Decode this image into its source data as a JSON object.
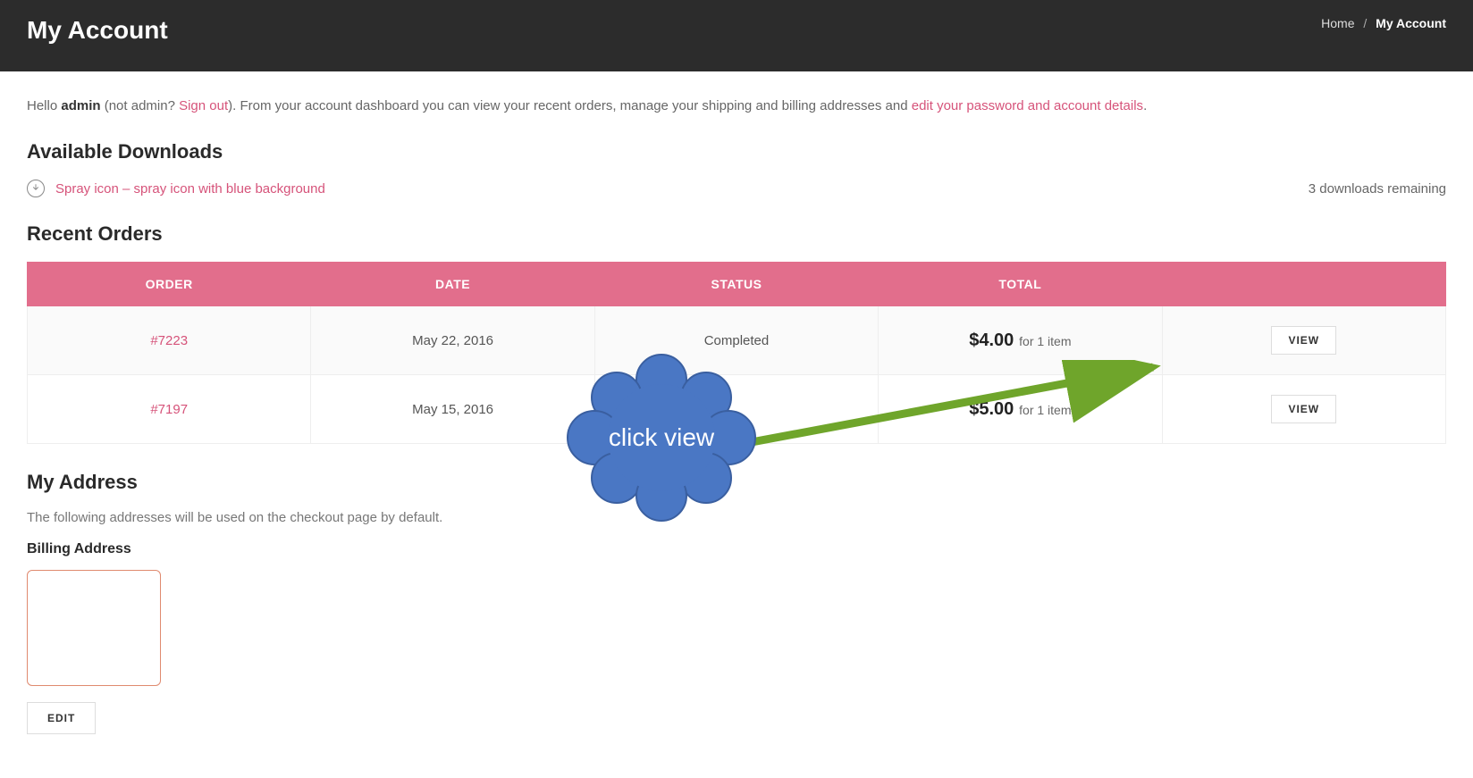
{
  "header": {
    "title": "My Account",
    "breadcrumb": {
      "home": "Home",
      "current": "My Account",
      "sep": "/"
    }
  },
  "intro": {
    "hello": "Hello ",
    "user": "admin",
    "not_user_prefix": " (not admin? ",
    "sign_out": "Sign out",
    "not_user_suffix": "). From your account dashboard you can view your recent orders, manage your shipping and billing addresses and ",
    "edit_details": "edit your password and account details",
    "period": "."
  },
  "downloads": {
    "title": "Available Downloads",
    "item": "Spray icon – spray icon with blue background",
    "remaining": "3 downloads remaining"
  },
  "orders": {
    "title": "Recent Orders",
    "headers": {
      "order": "ORDER",
      "date": "DATE",
      "status": "STATUS",
      "total": "TOTAL",
      "action": ""
    },
    "rows": [
      {
        "id": "#7223",
        "date": "May 22, 2016",
        "status": "Completed",
        "amount": "$4.00",
        "suffix": " for 1 item",
        "view": "VIEW"
      },
      {
        "id": "#7197",
        "date": "May 15, 2016",
        "status": "",
        "amount": "$5.00",
        "suffix": " for 1 item",
        "view": "VIEW"
      }
    ]
  },
  "address": {
    "title": "My Address",
    "desc": "The following addresses will be used on the checkout page by default.",
    "billing_title": "Billing Address",
    "edit": "EDIT"
  },
  "annotation": {
    "text": "click view"
  },
  "colors": {
    "accent": "#e26e8c",
    "link": "#d6537a",
    "callout": "#4a77c4",
    "arrow": "#6fa52b"
  }
}
